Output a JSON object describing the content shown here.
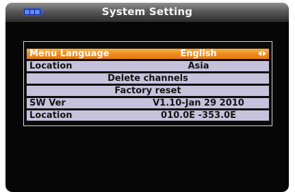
{
  "header": {
    "title": "System Setting",
    "battery_icon": "battery-icon",
    "colors": {
      "bar": "#5a5a5a",
      "battery": "#3a5fd0"
    }
  },
  "menu": {
    "colors": {
      "row": "#c7c2dc",
      "selected": "#ee8a1c"
    },
    "rows": [
      {
        "label": "Menu Language",
        "value": "English",
        "selected": true,
        "icon": "left-right-arrows-icon"
      },
      {
        "label": "Location",
        "value": "Asia"
      },
      {
        "value": "Delete channels"
      },
      {
        "value": "Factory reset"
      },
      {
        "label": "SW Ver",
        "value": "V1.10-Jan 29 2010"
      },
      {
        "label": "Location",
        "value": "010.0E -353.0E"
      }
    ]
  }
}
